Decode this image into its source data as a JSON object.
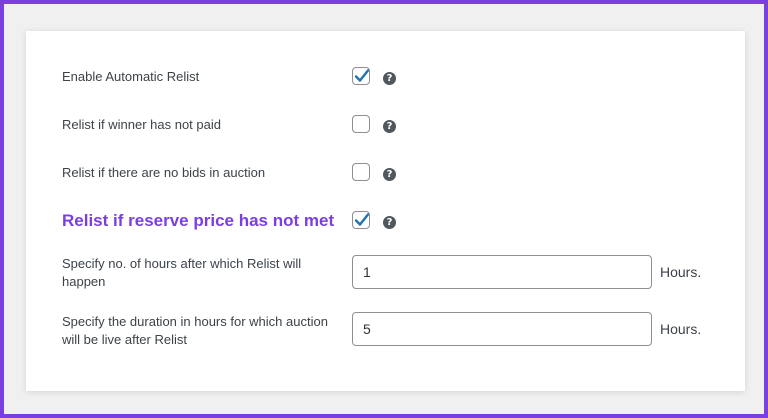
{
  "settings": {
    "rows": [
      {
        "label": "Enable Automatic Relist",
        "checked": true
      },
      {
        "label": "Relist if winner has not paid",
        "checked": false
      },
      {
        "label": "Relist if there are no bids in auction",
        "checked": false
      },
      {
        "label": "Relist if reserve price has not met",
        "checked": true
      }
    ],
    "help_glyph": "?",
    "hours_after": {
      "label": "Specify no. of hours after which Relist will happen",
      "value": "1",
      "unit": "Hours."
    },
    "duration": {
      "label": "Specify the duration in hours for which auction will be live after Relist",
      "value": "5",
      "unit": "Hours."
    }
  },
  "colors": {
    "accent": "#7b3fe0",
    "check": "#2271b1",
    "text": "#3c434a"
  }
}
